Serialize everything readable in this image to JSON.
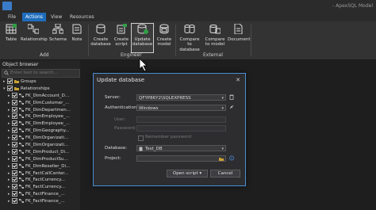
{
  "window": {
    "title": "- ApexSQL Model"
  },
  "tabs": [
    {
      "label": "File",
      "active": false
    },
    {
      "label": "Actions",
      "active": true
    },
    {
      "label": "View",
      "active": false
    },
    {
      "label": "Resources",
      "active": false
    }
  ],
  "ribbon": {
    "add": {
      "label": "Add",
      "buttons": [
        "Table",
        "Relationship",
        "Schema",
        "Note"
      ]
    },
    "engineer": {
      "label": "Engineer",
      "buttons": [
        "Create database",
        "Create script",
        "Update database",
        "Create model"
      ]
    },
    "external": {
      "label": "External",
      "buttons": [
        "Compare to database",
        "Compare to model",
        "Document"
      ]
    }
  },
  "browser": {
    "title": "Object browser",
    "search_placeholder": "Enter text to search...",
    "nodes": [
      "Groups",
      "Relationships",
      "FK_DimAccount_D...",
      "FK_DimCustomer_...",
      "FK_DimDepartmen...",
      "FK_DimEmployee_...",
      "FK_DimEmployee_...",
      "FK_DimGeography...",
      "FK_DimOrganizati...",
      "FK_DimOrganizati...",
      "FK_DimProduct_Di...",
      "FK_DimProductSu...",
      "FK_DimReseller_Di...",
      "FK_FactCallCenter...",
      "FK_FactCurrency...",
      "FK_FactCurrency...",
      "FK_FactFinance_...",
      "FK_FactFinance_..."
    ]
  },
  "dialog": {
    "title": "Update database",
    "server_label": "Server:",
    "server_value": "QFYP86Y2\\SQLEXPRESS",
    "auth_label": "Authentication:",
    "auth_value": "Windows",
    "user_label": "User:",
    "password_label": "Password:",
    "remember_label": "Remember password",
    "database_label": "Database:",
    "database_value": "Test_DB",
    "project_label": "Project:",
    "project_value": "",
    "open_script_label": "Open script",
    "cancel_label": "Cancel"
  },
  "colors": {
    "accent": "#1e6dbd",
    "dialog_border": "#4a8fd4"
  }
}
